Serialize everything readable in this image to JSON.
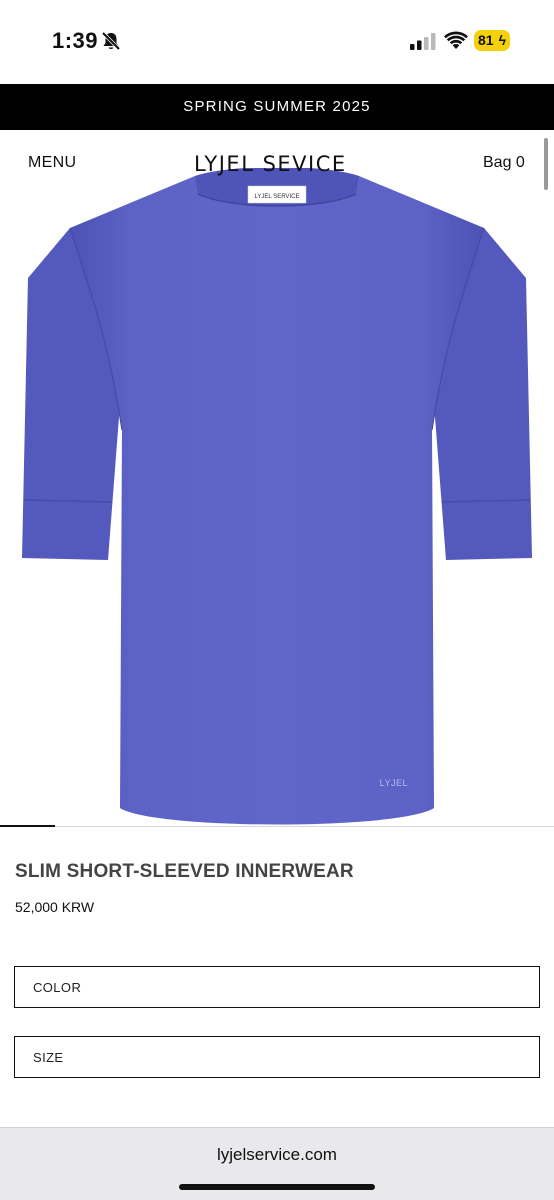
{
  "status_bar": {
    "time": "1:39",
    "battery_level": "81",
    "icons": [
      "bell-slash-icon",
      "signal-icon",
      "wifi-icon",
      "battery-charging-icon"
    ],
    "battery_color": "#f5d10a"
  },
  "announcement": {
    "text": "SPRING SUMMER 2025",
    "background": "#000000"
  },
  "header": {
    "menu_label": "MENU",
    "brand": "LYJEL SEVICE",
    "bag_label": "Bag 0"
  },
  "product_image": {
    "garment_color": "#5b61c4",
    "neck_tag_text": "LYJEL SERVICE",
    "hem_logo_text": "LYJEL"
  },
  "carousel": {
    "total_slides": 10,
    "active_slide": 1
  },
  "product": {
    "name": "SLIM SHORT-SLEEVED INNERWEAR",
    "price": "52,000 KRW"
  },
  "options": {
    "color_label": "COLOR",
    "size_label": "SIZE"
  },
  "browser": {
    "url": "lyjelservice.com"
  }
}
